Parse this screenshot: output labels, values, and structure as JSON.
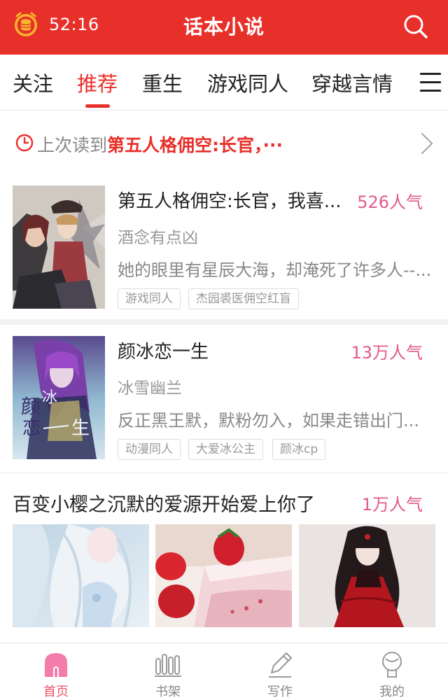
{
  "header": {
    "timer": "52:16",
    "title": "话本小说",
    "coin_icon": "coin-stack-alarm-icon",
    "search_icon": "search-icon",
    "color": "#e8302a"
  },
  "tabs": [
    {
      "label": "关注",
      "active": false
    },
    {
      "label": "推荐",
      "active": true
    },
    {
      "label": "重生",
      "active": false
    },
    {
      "label": "游戏同人",
      "active": false
    },
    {
      "label": "穿越言情",
      "active": false
    }
  ],
  "last_read": {
    "prefix": "上次读到",
    "title": "第五人格佣空:长官，···"
  },
  "books": [
    {
      "title": "第五人格佣空:长官，我喜...",
      "popularity": "526人气",
      "author": "酒念有点凶",
      "description": "她的眼里有星辰大海，却淹死了许多人--...",
      "tags": [
        "游戏同人",
        "杰园裘医佣空红盲"
      ]
    },
    {
      "title": "颜冰恋一生",
      "popularity": "13万人气",
      "author": "冰雪幽兰",
      "description": "反正黑王默，默粉勿入，如果走错出门...",
      "tags": [
        "动漫同人",
        "大爱冰公主",
        "颜冰cp"
      ],
      "cover_text": "颜冰恋一生"
    }
  ],
  "gallery": {
    "title": "百变小樱之沉默的爱源开始爱上你了",
    "popularity": "1万人气"
  },
  "bottom_nav": [
    {
      "label": "首页",
      "icon": "home-icon",
      "active": true
    },
    {
      "label": "书架",
      "icon": "bookshelf-icon",
      "active": false
    },
    {
      "label": "写作",
      "icon": "pen-icon",
      "active": false
    },
    {
      "label": "我的",
      "icon": "profile-icon",
      "active": false
    }
  ],
  "colors": {
    "brand_red": "#e8302a",
    "popularity_pink": "#e05a8d",
    "nav_active": "#e8536a"
  }
}
